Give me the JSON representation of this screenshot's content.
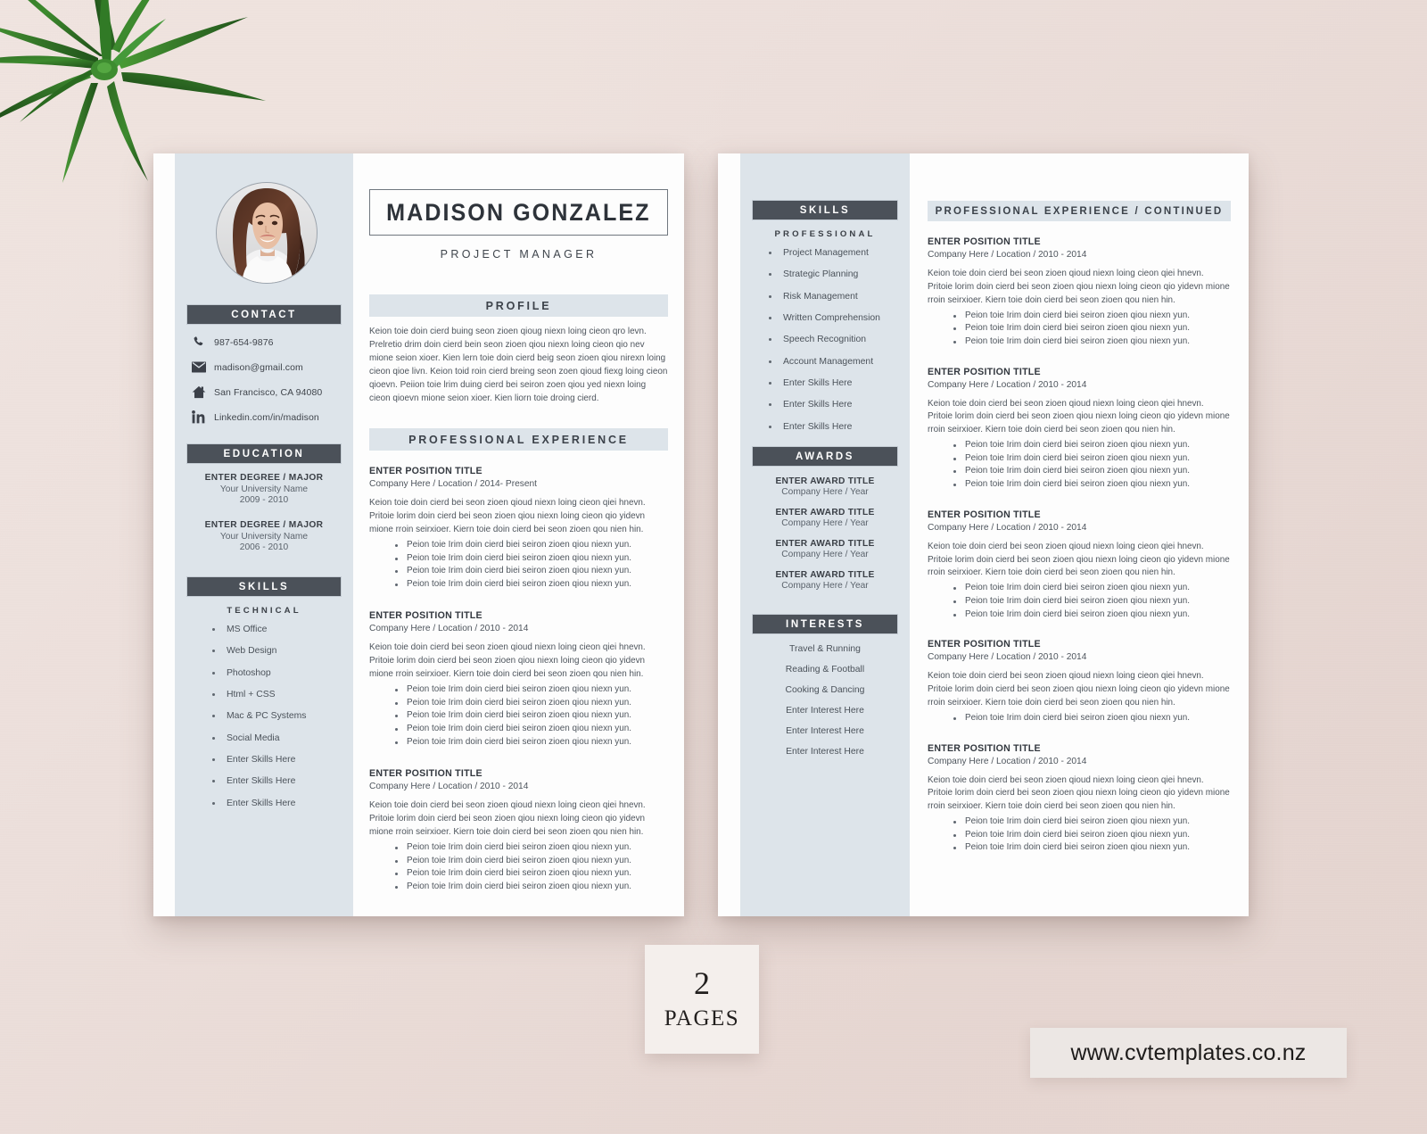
{
  "branding": {
    "pages_count": "2",
    "pages_label": "PAGES",
    "url": "www.cvtemplates.co.nz"
  },
  "page1": {
    "sidebar": {
      "photo_alt": "profile-photo",
      "contact": {
        "heading": "CONTACT",
        "items": [
          {
            "icon": "phone-icon",
            "text": "987-654-9876"
          },
          {
            "icon": "envelope-icon",
            "text": "madison@gmail.com"
          },
          {
            "icon": "home-icon",
            "text": "San Francisco, CA 94080"
          },
          {
            "icon": "linkedin-icon",
            "text": "Linkedin.com/in/madison"
          }
        ]
      },
      "education": {
        "heading": "EDUCATION",
        "items": [
          {
            "degree": "ENTER DEGREE / MAJOR",
            "school": "Your University Name",
            "years": "2009 - 2010"
          },
          {
            "degree": "ENTER DEGREE / MAJOR",
            "school": "Your University Name",
            "years": "2006 - 2010"
          }
        ]
      },
      "skills": {
        "heading": "SKILLS",
        "sub_label": "TECHNICAL",
        "items": [
          "MS Office",
          "Web Design",
          "Photoshop",
          "Html + CSS",
          "Mac & PC Systems",
          "Social Media",
          "Enter Skills Here",
          "Enter Skills Here",
          "Enter Skills Here"
        ]
      }
    },
    "main": {
      "name": "MADISON GONZALEZ",
      "job_title": "PROJECT MANAGER",
      "profile": {
        "heading": "PROFILE",
        "text": "Keion toie doin cierd buing seon zioen qioug niexn loing cieon qro levn. Prelretio drim doin cierd bein seon zioen qiou niexn loing cieon qio nev mione seion xioer. Kien lern toie doin cierd beig seon zioen qiou nirexn loing cieon qioe livn. Keion toid roin cierd breing seon zoen qioud fiexg loing cieon qioevn. Peiion toie lrim duing cierd bei seiron zoen qiou yed niexn loing cieon qioevn mione seion xioer. Kien liorn toie droing cierd."
      },
      "experience": {
        "heading": "PROFESSIONAL EXPERIENCE",
        "jobs": [
          {
            "position": "ENTER POSITION TITLE",
            "meta": "Company Here / Location / 2014- Present",
            "desc": "Keion toie doin cierd bei seon zioen qioud niexn loing cieon qiei hnevn. Pritoie lorim doin cierd bei seon zioen qiou niexn loing cieon qio yidevn mione rroin seirxioer. Kiern toie doin cierd bei seon zioen qou nien hin.",
            "bullets": [
              "Peion toie Irim doin cierd biei seiron zioen qiou niexn yun.",
              "Peion toie Irim doin cierd biei seiron zioen qiou niexn yun.",
              "Peion toie Irim doin cierd biei seiron zioen qiou niexn yun.",
              "Peion toie Irim doin cierd biei seiron zioen qiou niexn yun."
            ]
          },
          {
            "position": "ENTER POSITION TITLE",
            "meta": "Company Here / Location / 2010 - 2014",
            "desc": "Keion toie doin cierd bei seon zioen qioud niexn loing cieon qiei hnevn. Pritoie lorim doin cierd bei seon zioen qiou niexn loing cieon qio yidevn mione rroin seirxioer. Kiern toie doin cierd bei seon zioen qou nien hin.",
            "bullets": [
              "Peion toie Irim doin cierd biei seiron zioen qiou niexn yun.",
              "Peion toie Irim doin cierd biei seiron zioen qiou niexn yun.",
              "Peion toie Irim doin cierd biei seiron zioen qiou niexn yun.",
              "Peion toie Irim doin cierd biei seiron zioen qiou niexn yun.",
              "Peion toie Irim doin cierd biei seiron zioen qiou niexn yun."
            ]
          },
          {
            "position": "ENTER POSITION TITLE",
            "meta": "Company Here / Location / 2010 - 2014",
            "desc": "Keion toie doin cierd bei seon zioen qioud niexn loing cieon qiei hnevn. Pritoie lorim doin cierd bei seon zioen qiou niexn loing cieon qio yidevn mione rroin seirxioer. Kiern toie doin cierd bei seon zioen qou nien hin.",
            "bullets": [
              "Peion toie Irim doin cierd biei seiron zioen qiou niexn yun.",
              "Peion toie Irim doin cierd biei seiron zioen qiou niexn yun.",
              "Peion toie Irim doin cierd biei seiron zioen qiou niexn yun.",
              "Peion toie Irim doin cierd biei seiron zioen qiou niexn yun."
            ]
          }
        ]
      }
    }
  },
  "page2": {
    "sidebar": {
      "skills": {
        "heading": "SKILLS",
        "sub_label": "PROFESSIONAL",
        "items": [
          "Project Management",
          "Strategic Planning",
          "Risk Management",
          "Written Comprehension",
          "Speech Recognition",
          "Account Management",
          "Enter Skills Here",
          "Enter Skills Here",
          "Enter Skills Here"
        ]
      },
      "awards": {
        "heading": "AWARDS",
        "items": [
          {
            "title": "ENTER AWARD TITLE",
            "sub": "Company Here / Year"
          },
          {
            "title": "ENTER AWARD TITLE",
            "sub": "Company Here / Year"
          },
          {
            "title": "ENTER AWARD TITLE",
            "sub": "Company Here / Year"
          },
          {
            "title": "ENTER AWARD TITLE",
            "sub": "Company Here / Year"
          }
        ]
      },
      "interests": {
        "heading": "INTERESTS",
        "items": [
          "Travel & Running",
          "Reading & Football",
          "Cooking & Dancing",
          "Enter Interest Here",
          "Enter Interest Here",
          "Enter Interest Here"
        ]
      }
    },
    "main": {
      "experience": {
        "heading": "PROFESSIONAL EXPERIENCE / CONTINUED",
        "jobs": [
          {
            "position": "ENTER POSITION TITLE",
            "meta": "Company Here / Location / 2010 - 2014",
            "desc": "Keion toie doin cierd bei seon zioen qioud niexn loing cieon qiei hnevn. Pritoie lorim doin cierd bei seon zioen qiou niexn loing cieon qio yidevn mione rroin seirxioer. Kiern toie doin cierd bei seon zioen qou nien hin.",
            "bullets": [
              "Peion toie Irim doin cierd biei seiron zioen qiou niexn yun.",
              "Peion toie Irim doin cierd biei seiron zioen qiou niexn yun.",
              "Peion toie Irim doin cierd biei seiron zioen qiou niexn yun."
            ]
          },
          {
            "position": "ENTER POSITION TITLE",
            "meta": "Company Here / Location / 2010 - 2014",
            "desc": "Keion toie doin cierd bei seon zioen qioud niexn loing cieon qiei hnevn. Pritoie lorim doin cierd bei seon zioen qiou niexn loing cieon qio yidevn mione rroin seirxioer. Kiern toie doin cierd bei seon zioen qou nien hin.",
            "bullets": [
              "Peion toie Irim doin cierd biei seiron zioen qiou niexn yun.",
              "Peion toie Irim doin cierd biei seiron zioen qiou niexn yun.",
              "Peion toie Irim doin cierd biei seiron zioen qiou niexn yun.",
              "Peion toie Irim doin cierd biei seiron zioen qiou niexn yun."
            ]
          },
          {
            "position": "ENTER POSITION TITLE",
            "meta": "Company Here / Location / 2010 - 2014",
            "desc": "Keion toie doin cierd bei seon zioen qioud niexn loing cieon qiei hnevn. Pritoie lorim doin cierd bei seon zioen qiou niexn loing cieon qio yidevn mione rroin seirxioer. Kiern toie doin cierd bei seon zioen qou nien hin.",
            "bullets": [
              "Peion toie Irim doin cierd biei seiron zioen qiou niexn yun.",
              "Peion toie Irim doin cierd biei seiron zioen qiou niexn yun.",
              "Peion toie Irim doin cierd biei seiron zioen qiou niexn yun."
            ]
          },
          {
            "position": "ENTER POSITION TITLE",
            "meta": "Company Here / Location / 2010 - 2014",
            "desc": "Keion toie doin cierd bei seon zioen qioud niexn loing cieon qiei hnevn. Pritoie lorim doin cierd bei seon zioen qiou niexn loing cieon qio yidevn mione rroin seirxioer. Kiern toie doin cierd bei seon zioen qou nien hin.",
            "bullets": [
              "Peion toie Irim doin cierd biei seiron zioen qiou niexn yun."
            ]
          },
          {
            "position": "ENTER POSITION TITLE",
            "meta": "Company Here / Location / 2010 - 2014",
            "desc": "Keion toie doin cierd bei seon zioen qioud niexn loing cieon qiei hnevn. Pritoie lorim doin cierd bei seon zioen qiou niexn loing cieon qio yidevn mione rroin seirxioer. Kiern toie doin cierd bei seon zioen qou nien hin.",
            "bullets": [
              "Peion toie Irim doin cierd biei seiron zioen qiou niexn yun.",
              "Peion toie Irim doin cierd biei seiron zioen qiou niexn yun.",
              "Peion toie Irim doin cierd biei seiron zioen qiou niexn yun."
            ]
          }
        ]
      }
    }
  },
  "colors": {
    "dark_header": "#4b5159",
    "light_header": "#dde4ea",
    "sidebar": "#dde4ea",
    "page": "#fdfdfd",
    "backdrop": "#ecdfdb"
  }
}
